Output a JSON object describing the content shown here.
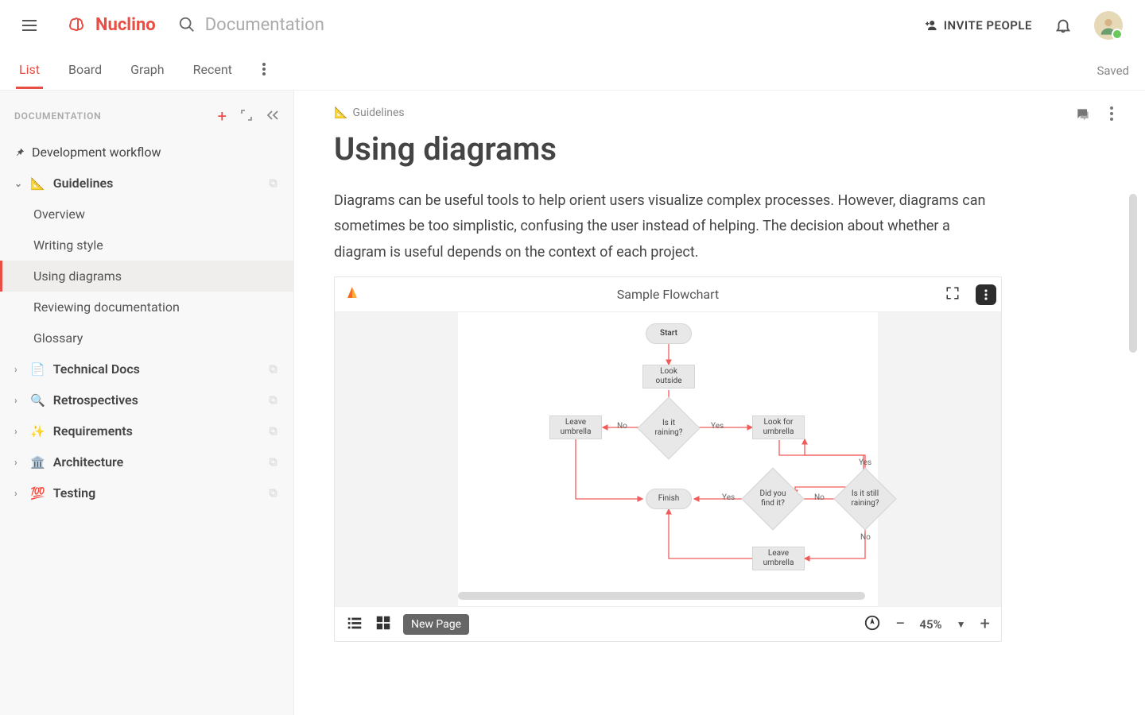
{
  "header": {
    "brand": "Nuclino",
    "workspace": "Documentation",
    "invite_label": "INVITE PEOPLE"
  },
  "subnav": {
    "tabs": [
      "List",
      "Board",
      "Graph",
      "Recent"
    ],
    "active_index": 0,
    "status": "Saved"
  },
  "sidebar": {
    "title": "DOCUMENTATION",
    "pinned": {
      "label": "Development workflow"
    },
    "sections": [
      {
        "emoji": "📐",
        "label": "Guidelines",
        "expanded": true,
        "children": [
          {
            "label": "Overview"
          },
          {
            "label": "Writing style"
          },
          {
            "label": "Using diagrams",
            "active": true
          },
          {
            "label": "Reviewing documentation"
          },
          {
            "label": "Glossary"
          }
        ]
      },
      {
        "emoji": "📄",
        "label": "Technical Docs",
        "expanded": false
      },
      {
        "emoji": "🔍",
        "label": "Retrospectives",
        "expanded": false
      },
      {
        "emoji": "✨",
        "label": "Requirements",
        "expanded": false
      },
      {
        "emoji": "🏛️",
        "label": "Architecture",
        "expanded": false
      },
      {
        "emoji": "💯",
        "label": "Testing",
        "expanded": false
      }
    ]
  },
  "page": {
    "breadcrumb_emoji": "📐",
    "breadcrumb_label": "Guidelines",
    "title": "Using diagrams",
    "body": "Diagrams can be useful tools to help orient users visualize complex processes. However, diagrams can sometimes be too simplistic, confusing the user instead of helping. The decision about whether a diagram is useful depends on the context of each project."
  },
  "embed": {
    "title": "Sample Flowchart",
    "new_page_label": "New Page",
    "zoom": "45%",
    "nodes": {
      "start": "Start",
      "look_outside": "Look outside",
      "is_raining": "Is it raining?",
      "leave_umbrella": "Leave umbrella",
      "look_for_umbrella": "Look for umbrella",
      "did_find": "Did you find it?",
      "still_raining": "Is it still raining?",
      "finish": "Finish",
      "leave_umbrella2": "Leave umbrella"
    },
    "labels": {
      "yes": "Yes",
      "no": "No"
    }
  }
}
